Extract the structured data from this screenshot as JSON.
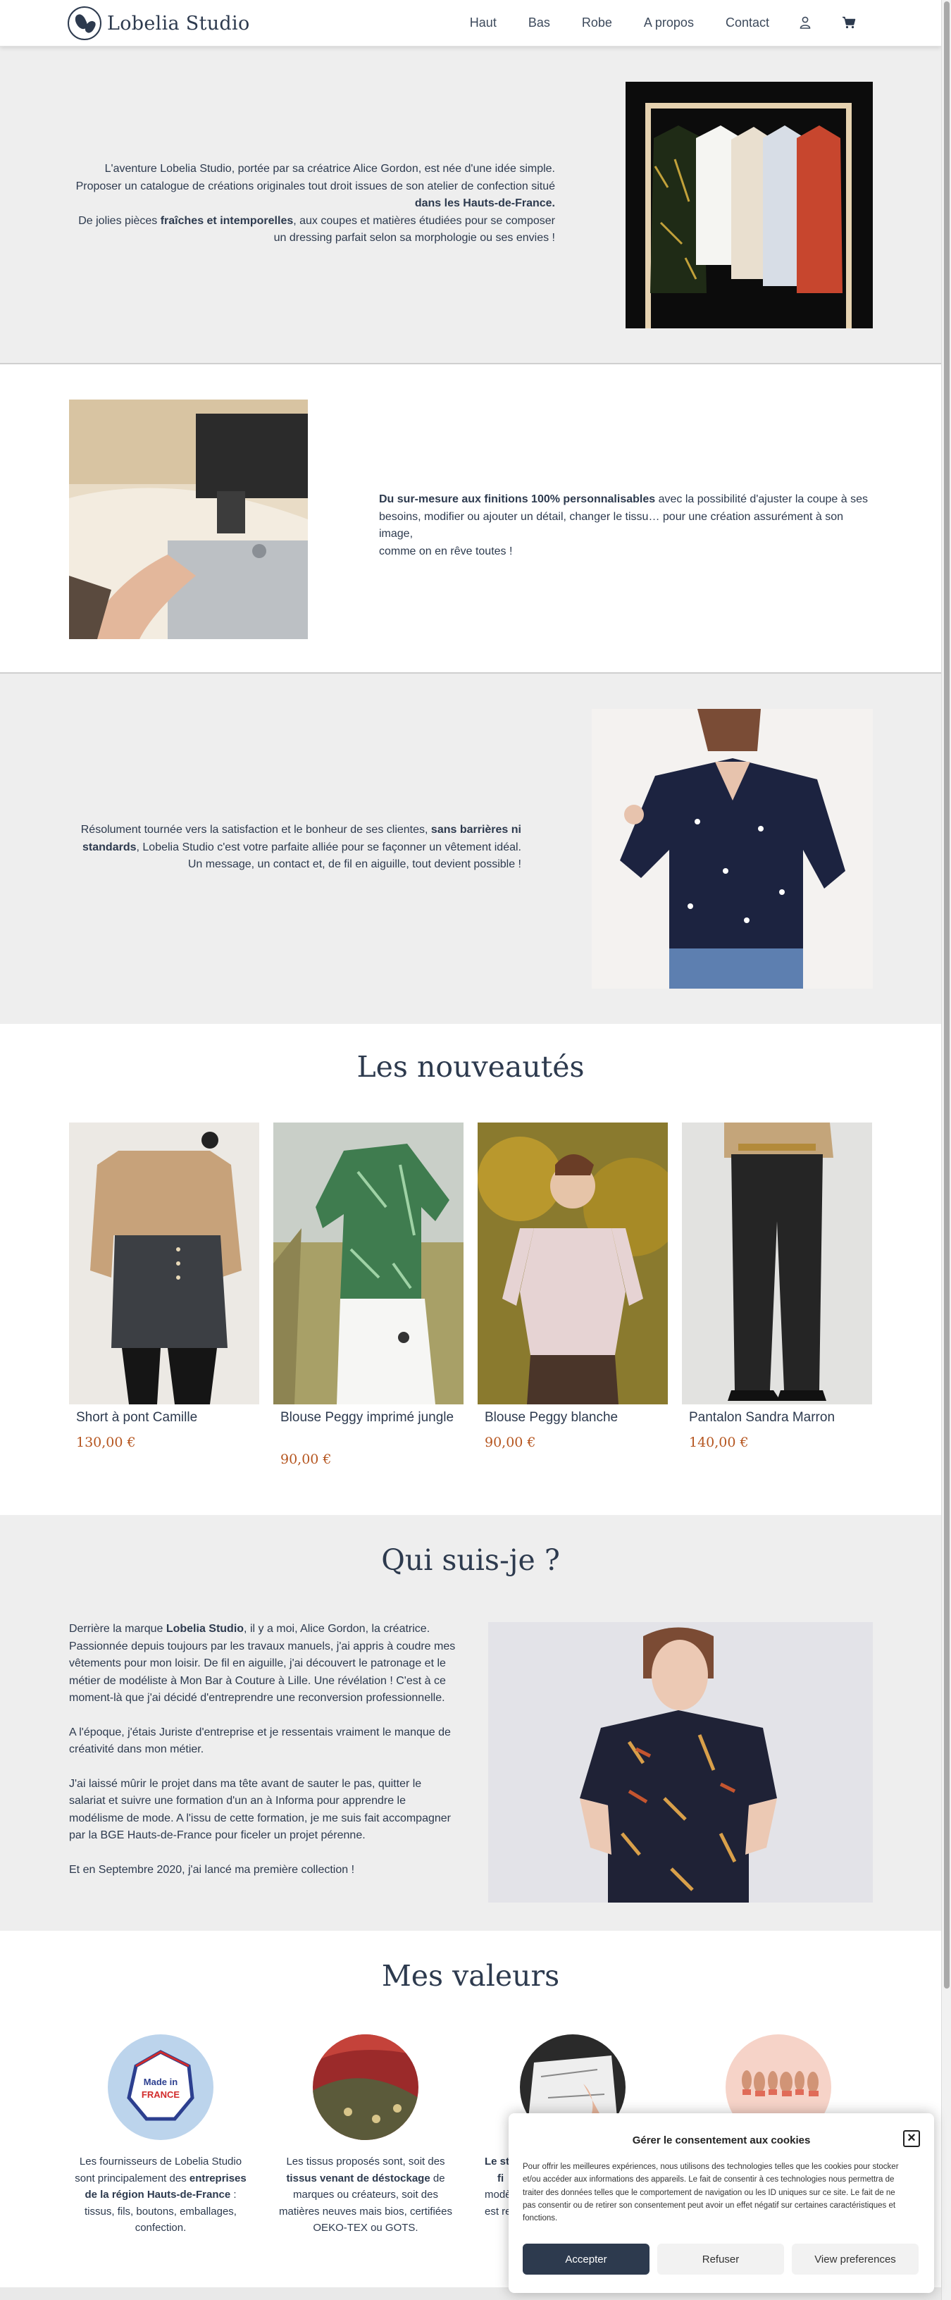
{
  "header": {
    "logo_text": "Lobelia Studio",
    "nav": [
      "Haut",
      "Bas",
      "Robe",
      "A propos",
      "Contact"
    ],
    "icons": [
      "user-icon",
      "cart-icon"
    ]
  },
  "intro": {
    "s1_line1": "L'aventure Lobelia Studio, portée par sa créatrice Alice Gordon, est née d'une idée simple.",
    "s1_line2": "Proposer un catalogue de créations originales tout droit issues de son atelier de confection situé",
    "s1_line3_bold": "dans les Hauts-de-France.",
    "s1_line4_pre": "De jolies pièces ",
    "s1_line4_bold": "fraîches et intemporelles",
    "s1_line4_post": ", aux coupes et matières étudiées pour se composer",
    "s1_line5": "un dressing parfait selon sa morphologie ou ses envies !",
    "s2_bold": "Du sur-mesure aux finitions 100% personnalisables",
    "s2_line1_post": " avec la possibilité d'ajuster la coupe à ses",
    "s2_line2": "besoins, modifier ou ajouter un détail, changer le tissu… pour une création assurément à son image,",
    "s2_line3": "comme on en rêve toutes !",
    "s3_line1_pre": "Résolument tournée vers la satisfaction et le bonheur de ses clientes, ",
    "s3_line1_bold": "sans barrières ni",
    "s3_line2_bold": "standards",
    "s3_line2_post": ", Lobelia Studio c'est votre parfaite alliée pour se façonner un vêtement idéal.",
    "s3_line3": "Un message, un contact et, de fil en aiguille, tout devient possible !"
  },
  "news": {
    "title": "Les nouveautés",
    "products": [
      {
        "name": "Short à pont Camille",
        "price": "130,00 €"
      },
      {
        "name": "Blouse Peggy imprimé jungle",
        "price": "90,00 €"
      },
      {
        "name": "Blouse Peggy blanche",
        "price": "90,00 €"
      },
      {
        "name": "Pantalon Sandra Marron",
        "price": "140,00 €"
      }
    ]
  },
  "about": {
    "title": "Qui suis-je ?",
    "p1_pre": "Derrière la marque ",
    "p1_bold": "Lobelia Studio",
    "p1_line1_post": ", il y a moi, Alice Gordon, la créatrice.",
    "p1_line2": "Passionnée depuis toujours par les travaux manuels, j'ai appris à coudre mes",
    "p1_line3": "vêtements pour mon loisir. De fil en aiguille, j'ai découvert le patronage et le",
    "p1_line4": "métier de modéliste à Mon Bar à Couture à Lille. Une révélation ! C'est à ce",
    "p1_line5": "moment-là que j'ai décidé d'entreprendre une reconversion professionnelle.",
    "p2_line1": "A l'époque, j'étais Juriste d'entreprise et je ressentais vraiment le manque de",
    "p2_line2": "créativité dans mon métier.",
    "p3_line1": "J'ai laissé mûrir le projet dans ma tête avant de sauter le pas, quitter le",
    "p3_line2": "salariat et suivre une formation d'un an à Informa pour apprendre le",
    "p3_line3": "modélisme de mode. A l'issu de cette formation, je me suis fait accompagner",
    "p3_line4": "par la BGE Hauts-de-France pour ficeler un projet pérenne.",
    "p4": "Et en Septembre 2020, j'ai lancé ma première collection !"
  },
  "values": {
    "title": "Mes valeurs",
    "made_in_line1": "Made in",
    "made_in_line2": "FRANCE",
    "v1_line1": "Les fournisseurs de Lobelia Studio",
    "v1_line2_pre": "sont principalement des ",
    "v1_line2_bold": "entreprises",
    "v1_line3_bold": "de la région Hauts-de-France",
    "v1_line3_post": " :",
    "v1_line4": "tissus, fils, boutons, emballages,",
    "v1_line5": "confection.",
    "v2_line1": "Les tissus proposés sont, soit des",
    "v2_line2_bold": "tissus venant de déstockage",
    "v2_line2_post": " de",
    "v2_line3": "marques ou créateurs, soit des",
    "v2_line4": "matières neuves mais bios, certifiées",
    "v2_line5": "OEKO-TEX ou GOTS.",
    "v3_line1_bold": "Le st",
    "v3_line2_bold": "fi",
    "v3_line3": "modè",
    "v3_line4": "est re"
  },
  "consent": {
    "title": "Gérer le consentement aux cookies",
    "body_line1": "Pour offrir les meilleures expériences, nous utilisons des technologies telles que les cookies pour stocker",
    "body_line2": "et/ou accéder aux informations des appareils. Le fait de consentir à ces technologies nous permettra de",
    "body_line3": "traiter des données telles que le comportement de navigation ou les ID uniques sur ce site. Le fait de ne",
    "body_line4": "pas consentir ou de retirer son consentement peut avoir un effet négatif sur certaines caractéristiques et",
    "body_line5": "fonctions.",
    "accept": "Accepter",
    "refuse": "Refuser",
    "prefs": "View preferences"
  },
  "colors": {
    "primary": "#2d3a4e",
    "price": "#b5551f",
    "band_grey": "#eeeeee"
  }
}
